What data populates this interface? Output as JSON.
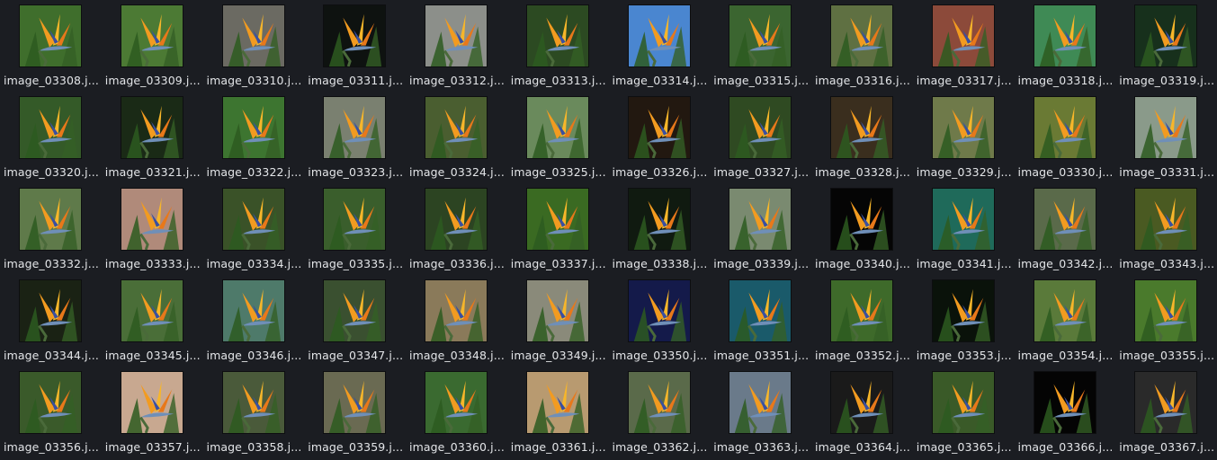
{
  "file_browser": {
    "files": [
      {
        "name": "image_03308.j...",
        "bg": "#3f6e2c",
        "icon": "flower-photo"
      },
      {
        "name": "image_03309.j...",
        "bg": "#4c7a34",
        "icon": "flower-photo"
      },
      {
        "name": "image_03310.j...",
        "bg": "#6b6a62",
        "icon": "flower-photo"
      },
      {
        "name": "image_03311.j...",
        "bg": "#0e1210",
        "icon": "flower-photo"
      },
      {
        "name": "image_03312.j...",
        "bg": "#8c8f8a",
        "icon": "flower-photo"
      },
      {
        "name": "image_03313.j...",
        "bg": "#2c4a22",
        "icon": "flower-photo"
      },
      {
        "name": "image_03314.j...",
        "bg": "#4a86d0",
        "icon": "flower-photo"
      },
      {
        "name": "image_03315.j...",
        "bg": "#3b6530",
        "icon": "flower-photo"
      },
      {
        "name": "image_03316.j...",
        "bg": "#5f7042",
        "icon": "flower-photo"
      },
      {
        "name": "image_03317.j...",
        "bg": "#8c4a3a",
        "icon": "flower-photo"
      },
      {
        "name": "image_03318.j...",
        "bg": "#3f8a55",
        "icon": "flower-photo"
      },
      {
        "name": "image_03319.j...",
        "bg": "#17301c",
        "icon": "flower-photo"
      },
      {
        "name": "image_03320.j...",
        "bg": "#345a28",
        "icon": "flower-photo"
      },
      {
        "name": "image_03321.j...",
        "bg": "#1a2a16",
        "icon": "flower-photo"
      },
      {
        "name": "image_03322.j...",
        "bg": "#3d7530",
        "icon": "flower-photo"
      },
      {
        "name": "image_03323.j...",
        "bg": "#7a8070",
        "icon": "flower-photo"
      },
      {
        "name": "image_03324.j...",
        "bg": "#4a5e30",
        "icon": "flower-photo"
      },
      {
        "name": "image_03325.j...",
        "bg": "#6a8a5c",
        "icon": "flower-photo"
      },
      {
        "name": "image_03326.j...",
        "bg": "#221810",
        "icon": "flower-photo"
      },
      {
        "name": "image_03327.j...",
        "bg": "#2f4a22",
        "icon": "flower-photo"
      },
      {
        "name": "image_03328.j...",
        "bg": "#3a2e1e",
        "icon": "flower-photo"
      },
      {
        "name": "image_03329.j...",
        "bg": "#6f7a4a",
        "icon": "flower-photo"
      },
      {
        "name": "image_03330.j...",
        "bg": "#6a7a34",
        "icon": "flower-photo"
      },
      {
        "name": "image_03331.j...",
        "bg": "#8a9a8a",
        "icon": "flower-photo"
      },
      {
        "name": "image_03332.j...",
        "bg": "#5f7a4a",
        "icon": "flower-photo"
      },
      {
        "name": "image_03333.j...",
        "bg": "#b08a7a",
        "icon": "flower-photo"
      },
      {
        "name": "image_03334.j...",
        "bg": "#3a5228",
        "icon": "flower-photo"
      },
      {
        "name": "image_03335.j...",
        "bg": "#3a5e2c",
        "icon": "flower-photo"
      },
      {
        "name": "image_03336.j...",
        "bg": "#2c4422",
        "icon": "flower-photo"
      },
      {
        "name": "image_03337.j...",
        "bg": "#3a6a22",
        "icon": "flower-photo"
      },
      {
        "name": "image_03338.j...",
        "bg": "#101a10",
        "icon": "flower-photo"
      },
      {
        "name": "image_03339.j...",
        "bg": "#7a8a70",
        "icon": "flower-photo"
      },
      {
        "name": "image_03340.j...",
        "bg": "#050505",
        "icon": "flower-photo"
      },
      {
        "name": "image_03341.j...",
        "bg": "#1f6a5a",
        "icon": "flower-photo"
      },
      {
        "name": "image_03342.j...",
        "bg": "#5a6a4a",
        "icon": "flower-photo"
      },
      {
        "name": "image_03343.j...",
        "bg": "#4a5a22",
        "icon": "flower-photo"
      },
      {
        "name": "image_03344.j...",
        "bg": "#1a2214",
        "icon": "flower-photo"
      },
      {
        "name": "image_03345.j...",
        "bg": "#4a6e38",
        "icon": "flower-photo"
      },
      {
        "name": "image_03346.j...",
        "bg": "#4e7a6a",
        "icon": "flower-photo"
      },
      {
        "name": "image_03347.j...",
        "bg": "#3a5030",
        "icon": "flower-photo"
      },
      {
        "name": "image_03348.j...",
        "bg": "#8a7a5a",
        "icon": "flower-photo"
      },
      {
        "name": "image_03349.j...",
        "bg": "#8a8a7a",
        "icon": "flower-photo"
      },
      {
        "name": "image_03350.j...",
        "bg": "#141a4a",
        "icon": "flower-photo"
      },
      {
        "name": "image_03351.j...",
        "bg": "#1a5a6a",
        "icon": "flower-photo"
      },
      {
        "name": "image_03352.j...",
        "bg": "#3e6a2a",
        "icon": "flower-photo"
      },
      {
        "name": "image_03353.j...",
        "bg": "#0a120a",
        "icon": "flower-photo"
      },
      {
        "name": "image_03354.j...",
        "bg": "#5a7a3a",
        "icon": "flower-photo"
      },
      {
        "name": "image_03355.j...",
        "bg": "#4a7a2c",
        "icon": "flower-photo"
      },
      {
        "name": "image_03356.j...",
        "bg": "#3a5a2a",
        "icon": "flower-photo"
      },
      {
        "name": "image_03357.j...",
        "bg": "#c8a890",
        "icon": "flower-photo"
      },
      {
        "name": "image_03358.j...",
        "bg": "#4a5a3a",
        "icon": "flower-photo"
      },
      {
        "name": "image_03359.j...",
        "bg": "#6a6a52",
        "icon": "flower-photo"
      },
      {
        "name": "image_03360.j...",
        "bg": "#3a6a30",
        "icon": "flower-photo"
      },
      {
        "name": "image_03361.j...",
        "bg": "#b89a70",
        "icon": "flower-photo"
      },
      {
        "name": "image_03362.j...",
        "bg": "#5a6a4a",
        "icon": "flower-photo"
      },
      {
        "name": "image_03363.j...",
        "bg": "#6a7a8a",
        "icon": "flower-photo"
      },
      {
        "name": "image_03364.j...",
        "bg": "#1a1a1a",
        "icon": "flower-photo"
      },
      {
        "name": "image_03365.j...",
        "bg": "#3a5a28",
        "icon": "flower-photo"
      },
      {
        "name": "image_03366.j...",
        "bg": "#040404",
        "icon": "flower-photo"
      },
      {
        "name": "image_03367.j...",
        "bg": "#2a2a2a",
        "icon": "flower-photo"
      }
    ]
  }
}
